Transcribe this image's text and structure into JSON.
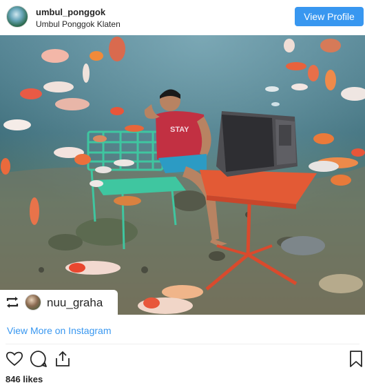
{
  "header": {
    "username": "umbul_ponggok",
    "location": "Umbul Ponggok Klaten",
    "view_profile_label": "View Profile"
  },
  "photo": {
    "description_icon": "underwater-photo",
    "shirt_text": "STAY"
  },
  "repost": {
    "icon": "repost-icon",
    "username": "nuu_graha"
  },
  "view_more_label": "View More on Instagram",
  "actions": {
    "like_icon": "heart-icon",
    "comment_icon": "comment-icon",
    "share_icon": "share-icon",
    "save_icon": "bookmark-icon"
  },
  "likes_text": "846 likes",
  "colors": {
    "accent": "#3897f0",
    "text": "#262626"
  }
}
